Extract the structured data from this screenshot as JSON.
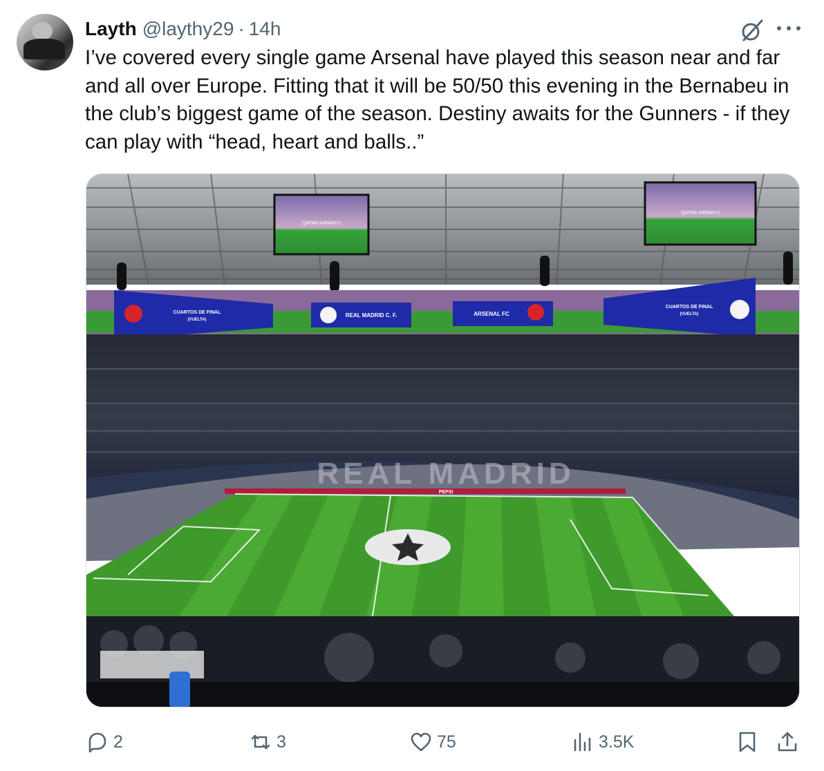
{
  "tweet": {
    "author_name": "Layth",
    "handle": "@laythy29",
    "separator": "·",
    "time": "14h",
    "text": "I’ve covered every single game Arsenal have played this season near and far and all over Europe. Fitting that it will be 50/50 this evening in the Bernabeu in the club’s biggest game of the season. Destiny awaits for the Gunners - if they can play with “head, heart and balls..”"
  },
  "photo": {
    "banner_left_text": "CUARTOS DE FINAL",
    "banner_left_sub": "(VUELTA)",
    "banner_real": "REAL MADRID C. F.",
    "banner_arsenal": "ARSENAL FC",
    "banner_right_text": "CUARTOS DE FINAL",
    "banner_right_sub": "(VUELTA)",
    "stand_text": "REAL MADRID",
    "screen_ad": "QATAR AIRWAYS",
    "board_pepsi": "PEPSI",
    "colors": {
      "banner_blue": "#1f2aa8",
      "pitch_green": "#3f9a2b",
      "stands_dark": "#1c2230"
    }
  },
  "actions": {
    "replies": "2",
    "reposts": "3",
    "likes": "75",
    "views": "3.5K"
  },
  "icons": [
    "grok-icon",
    "more-icon",
    "reply-icon",
    "repost-icon",
    "like-icon",
    "views-icon",
    "bookmark-icon",
    "share-icon"
  ]
}
